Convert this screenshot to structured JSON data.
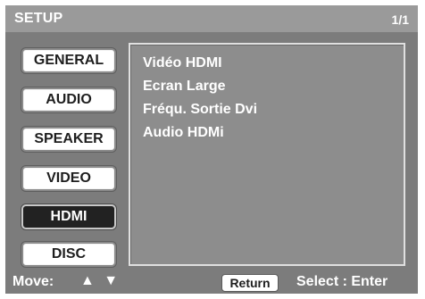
{
  "header": {
    "title": "SETUP",
    "page_counter": "1/1"
  },
  "menu": {
    "items": [
      {
        "label": "GENERAL",
        "active": false
      },
      {
        "label": "AUDIO",
        "active": false
      },
      {
        "label": "SPEAKER",
        "active": false
      },
      {
        "label": "VIDEO",
        "active": false
      },
      {
        "label": "HDMI",
        "active": true
      },
      {
        "label": "DISC",
        "active": false
      }
    ]
  },
  "options": [
    "Vidéo HDMI",
    "Ecran Large",
    "Fréqu. Sortie Dvi",
    "Audio HDMi"
  ],
  "footer": {
    "move_label": "Move:",
    "move_arrows": "▲ ▼",
    "return_label": "Return",
    "select_hint": "Select : Enter"
  },
  "colors": {
    "background": "#7c7c7c",
    "title_bar": "#9a9a9a",
    "panel": "#8d8d8d",
    "button_face": "#ffffff",
    "active_button": "#222222",
    "text": "#ffffff"
  },
  "icons": {
    "up_arrow": "up-arrow-icon",
    "down_arrow": "down-arrow-icon"
  }
}
